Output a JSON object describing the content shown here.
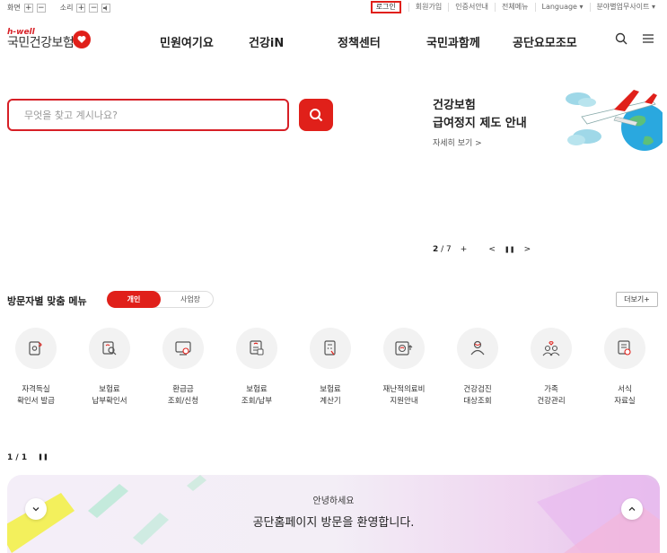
{
  "util": {
    "screen_label": "화면",
    "sound_label": "소리",
    "plus": "+",
    "minus": "−",
    "login": "로그인",
    "signup": "회원가입",
    "cert": "인증서안내",
    "allmenu": "전체메뉴",
    "language": "Language ▾",
    "sites": "분야별업무사이트 ▾"
  },
  "logo": {
    "top": "h-well",
    "name": "국민건강보험"
  },
  "gnb": [
    "민원여기요",
    "건강iN",
    "정책센터",
    "국민과함께",
    "공단요모조모"
  ],
  "search": {
    "placeholder": "무엇을 찾고 계시나요?"
  },
  "banner": {
    "line1": "건강보험",
    "line2": "급여정지 제도 안내",
    "more": "자세히 보기 >"
  },
  "pager": {
    "current": "2",
    "total": "/ 7",
    "plus": "+",
    "prev": "<",
    "pause": "❚❚",
    "next": ">"
  },
  "visitor": {
    "title": "방문자별 맞춤 메뉴",
    "tab_personal": "개인",
    "tab_business": "사업장",
    "more": "더보기+",
    "items": [
      {
        "label": "자격득실\n확인서 발급"
      },
      {
        "label": "보험료\n납부확인서"
      },
      {
        "label": "환급금\n조회/신청"
      },
      {
        "label": "보험료\n조회/납부"
      },
      {
        "label": "보험료\n계산기"
      },
      {
        "label": "재난적의료비\n지원안내"
      },
      {
        "label": "건강검진\n대상조회"
      },
      {
        "label": "가족\n건강관리"
      },
      {
        "label": "서식\n자료실"
      }
    ]
  },
  "pager2": {
    "text": "1 / 1",
    "pause": "❚❚"
  },
  "welcome": {
    "line1": "안녕하세요",
    "line2": "공단홈페이지 방문을 환영합니다."
  },
  "colors": {
    "accent": "#e0201a",
    "brand_red": "#d71f26"
  }
}
